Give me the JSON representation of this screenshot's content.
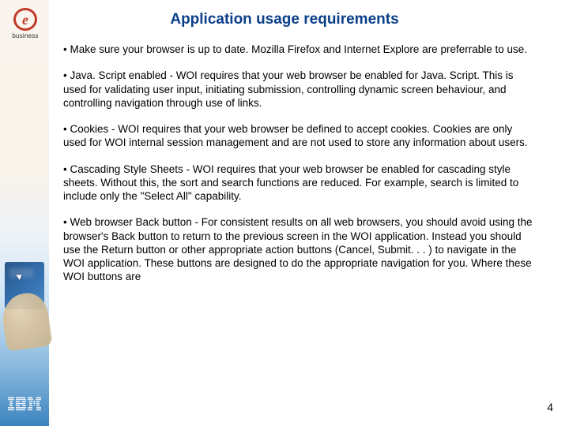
{
  "title": "Application usage requirements",
  "badge_letter": "e",
  "badge_label": "business",
  "bullets": [
    "• Make sure your browser is up to date. Mozilla Firefox and Internet Explore are preferrable to use.",
    "• Java. Script enabled - WOI requires that your web browser be enabled for Java. Script. This is used for validating user input, initiating submission, controlling dynamic screen behaviour, and controlling navigation through use of links.",
    "• Cookies - WOI requires that your web browser be defined to accept cookies. Cookies are only used for WOI internal session management and are not used to store any information about users.",
    "• Cascading Style Sheets - WOI requires that your web browser be enabled for cascading style sheets. Without this, the sort and search functions are reduced. For example, search is limited to include only the \"Select All\" capability.",
    "• Web browser Back button - For consistent results on all web browsers, you should avoid using the browser's Back button to return to the previous screen in the WOI application. Instead you should use the Return button or other appropriate action buttons (Cancel, Submit. . . ) to navigate in the WOI application. These buttons are designed to do the appropriate navigation for you. Where these WOI buttons are"
  ],
  "page_number": "4",
  "logo_name": "IBM"
}
